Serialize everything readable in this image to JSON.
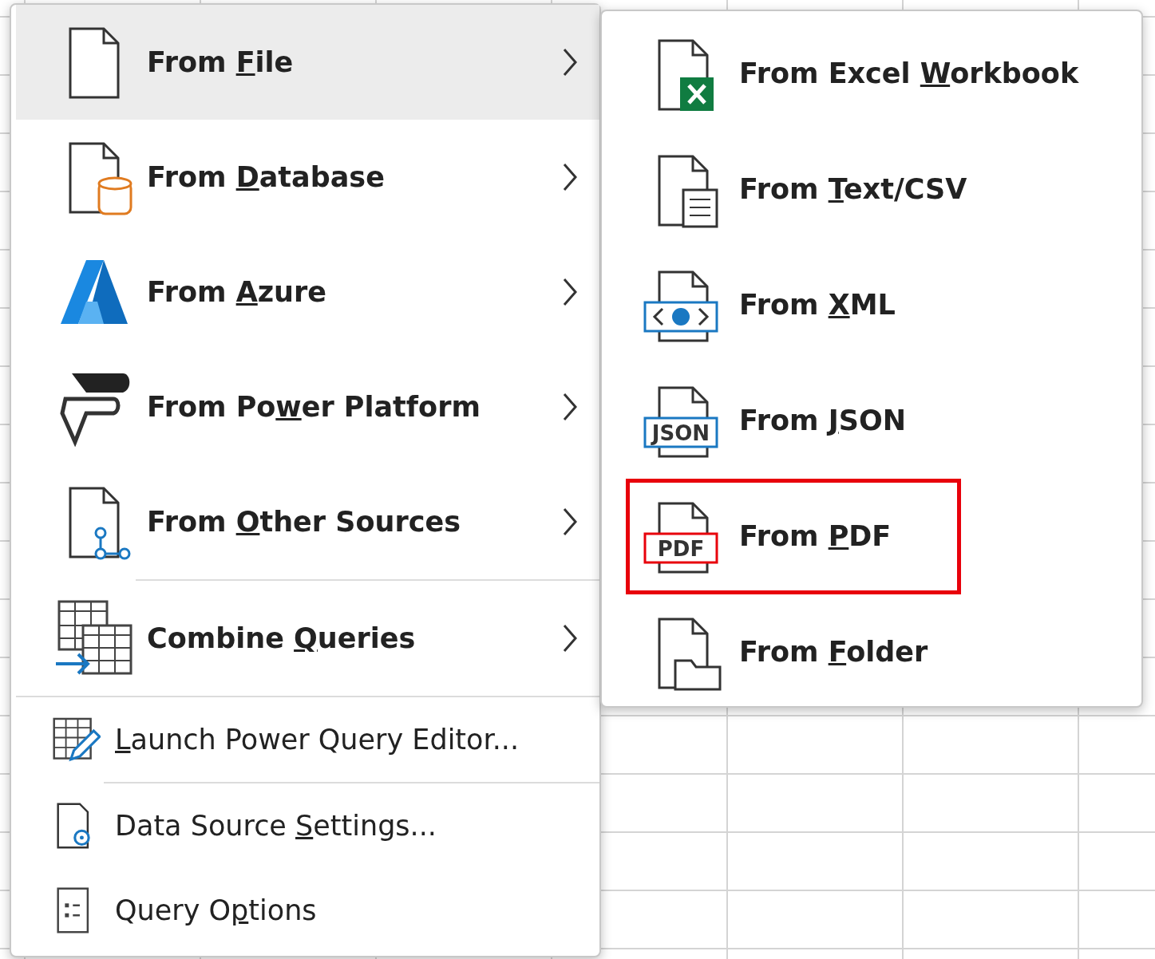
{
  "menu": {
    "items": [
      {
        "kind": "large",
        "label_before": "From ",
        "access_key": "F",
        "label_after": "ile",
        "selected": true,
        "submenu": true
      },
      {
        "kind": "large",
        "label_before": "From ",
        "access_key": "D",
        "label_after": "atabase",
        "selected": false,
        "submenu": true
      },
      {
        "kind": "large",
        "label_before": "From ",
        "access_key": "A",
        "label_after": "zure",
        "selected": false,
        "submenu": true
      },
      {
        "kind": "large",
        "label_before": "From Po",
        "access_key": "w",
        "label_after": "er Platform",
        "selected": false,
        "submenu": true
      },
      {
        "kind": "large",
        "label_before": "From ",
        "access_key": "O",
        "label_after": "ther Sources",
        "selected": false,
        "submenu": true
      },
      {
        "kind": "separator",
        "indented": true
      },
      {
        "kind": "large",
        "label_before": "Combine ",
        "access_key": "Q",
        "label_after": "ueries",
        "selected": false,
        "submenu": true
      },
      {
        "kind": "separator",
        "indented": false
      },
      {
        "kind": "small",
        "access_key": "L",
        "label_after": "aunch Power Query Editor...",
        "selected": false,
        "submenu": false
      },
      {
        "kind": "separator",
        "indented": true
      },
      {
        "kind": "small",
        "label_before": "Data Source ",
        "access_key": "S",
        "label_after": "ettings...",
        "selected": false,
        "submenu": false
      },
      {
        "kind": "small",
        "label_before": "Query O",
        "access_key": "p",
        "label_after": "tions",
        "selected": false,
        "submenu": false
      }
    ]
  },
  "submenu": {
    "items": [
      {
        "label_before": "From Excel ",
        "access_key": "W",
        "label_after": "orkbook",
        "highlighted": false
      },
      {
        "label_before": "From ",
        "access_key": "T",
        "label_after": "ext/CSV",
        "highlighted": false
      },
      {
        "label_before": "From ",
        "access_key": "X",
        "label_after": "ML",
        "highlighted": false
      },
      {
        "label_before": "From ",
        "access_key": "J",
        "label_after": "SON",
        "highlighted": false,
        "icon_label": "JSON"
      },
      {
        "label_before": "From ",
        "access_key": "P",
        "label_after": "DF",
        "highlighted": true,
        "icon_label": "PDF"
      },
      {
        "label_before": "From ",
        "access_key": "F",
        "label_after": "older",
        "highlighted": false
      }
    ]
  }
}
